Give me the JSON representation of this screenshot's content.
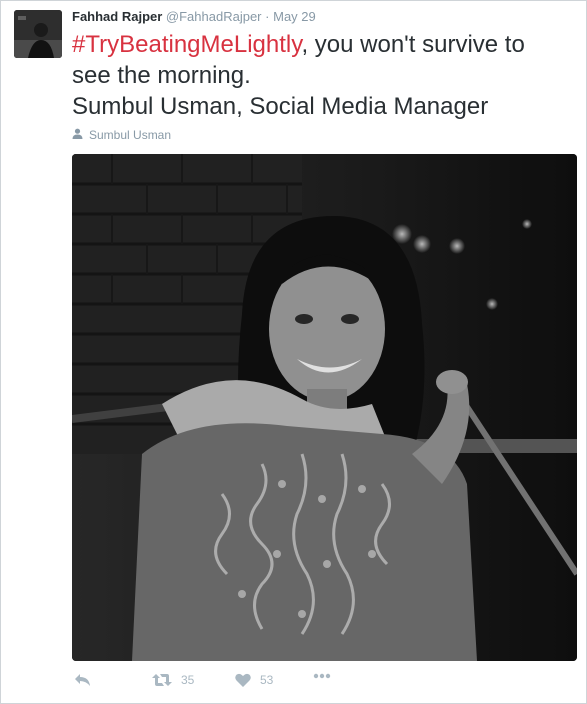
{
  "tweet": {
    "author_name": "Fahhad Rajper",
    "author_handle": "@FahhadRajper",
    "separator": "·",
    "date": "May 29",
    "hashtag": "#TryBeatingMeLightly",
    "text_line1_rest": ", you won't survive to",
    "text_line2": "see the morning.",
    "text_line3": "Sumbul Usman, Social Media Manager",
    "tagged_person": "Sumbul Usman"
  },
  "actions": {
    "retweet_count": "35",
    "like_count": "53"
  },
  "colors": {
    "hashtag": "#d83240",
    "meta_text": "#8899a6",
    "action_icon": "#aab8c2"
  },
  "icons": [
    "user-icon",
    "reply-icon",
    "retweet-icon",
    "heart-icon",
    "more-icon"
  ]
}
